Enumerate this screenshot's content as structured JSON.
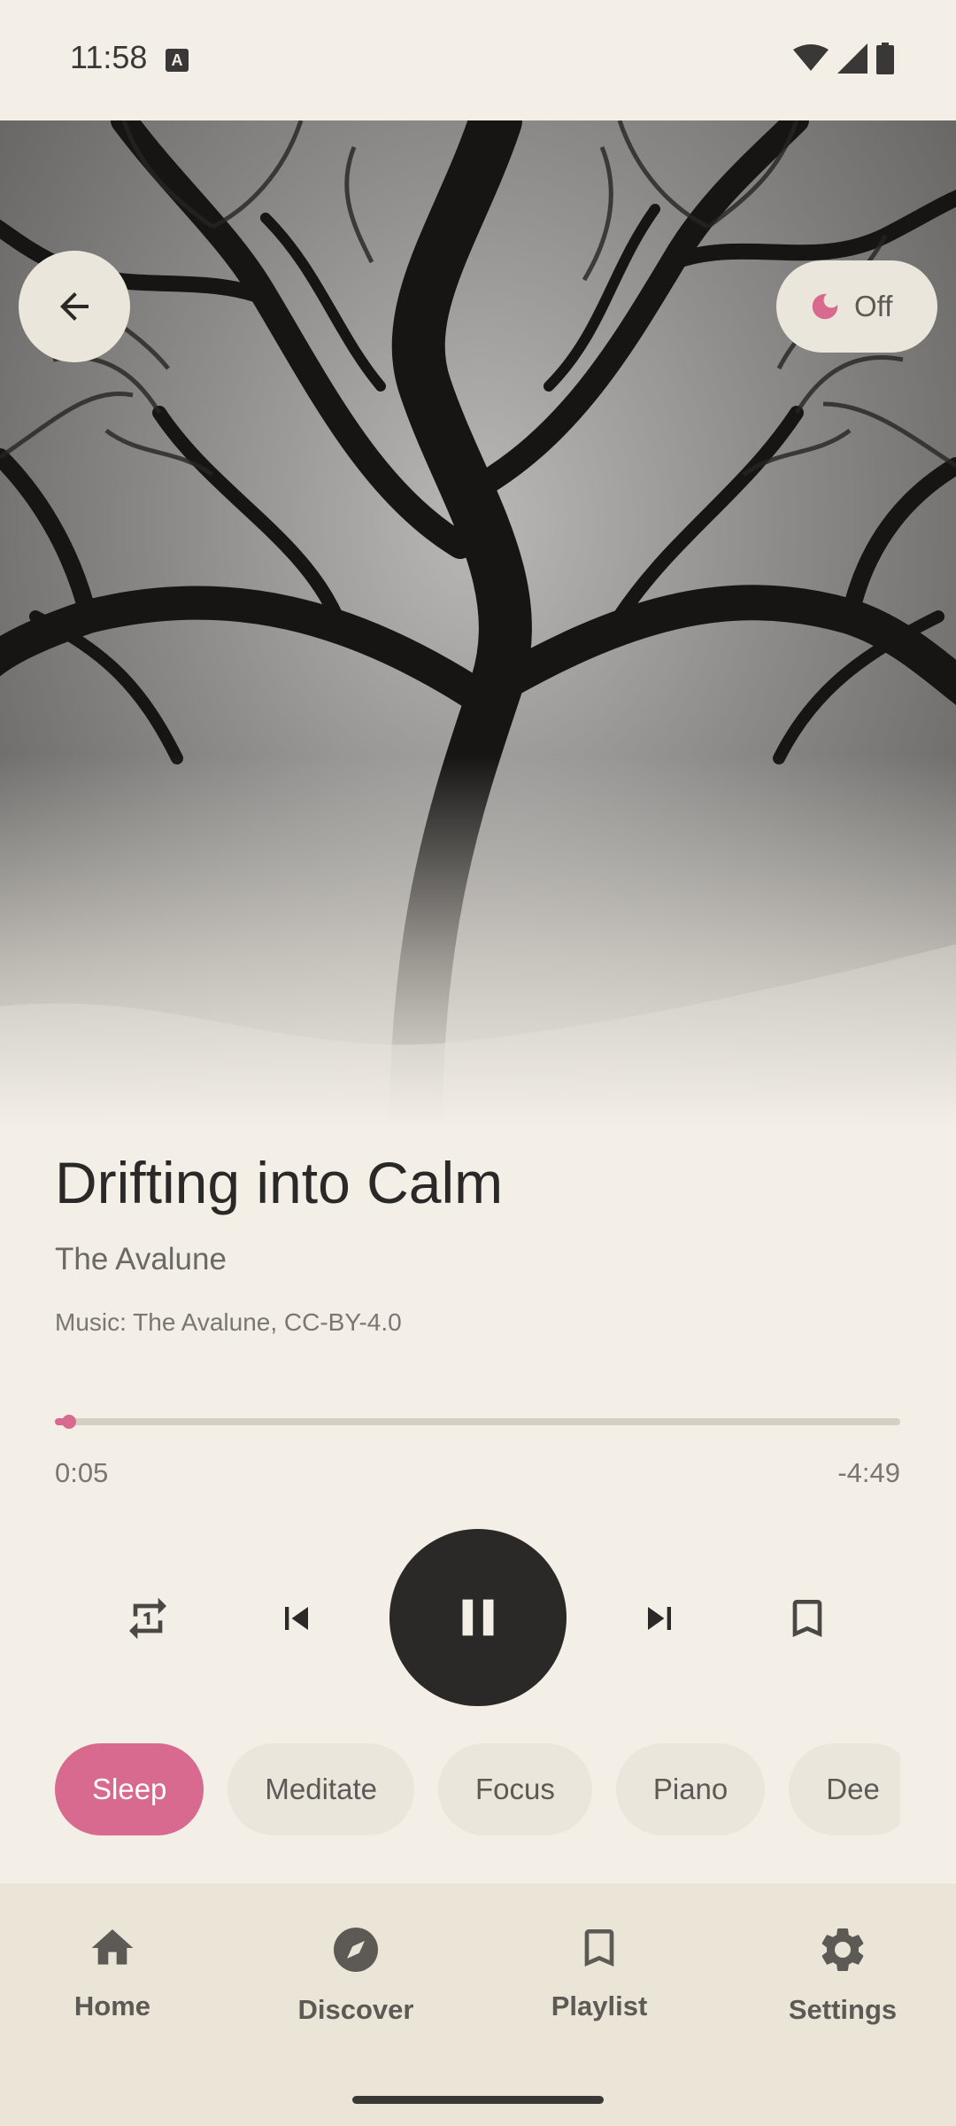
{
  "status_bar": {
    "time": "11:58",
    "notification_icon": "A"
  },
  "hero": {
    "image": "tree-silhouette-icon"
  },
  "back_button": {
    "icon": "arrow-back-icon"
  },
  "sleep_timer": {
    "icon": "moon-icon",
    "label": "Off"
  },
  "track": {
    "title": "Drifting into Calm",
    "artist": "The Avalune",
    "credit": "Music: The Avalune, CC-BY-4.0"
  },
  "progress": {
    "elapsed": "0:05",
    "remaining": "-4:49",
    "fraction": 0.017
  },
  "controls": {
    "repeat_icon": "repeat-one-icon",
    "prev_icon": "skip-previous-icon",
    "play_pause_icon": "pause-icon",
    "next_icon": "skip-next-icon",
    "bookmark_icon": "bookmark-icon"
  },
  "categories": [
    {
      "label": "Sleep",
      "active": true
    },
    {
      "label": "Meditate",
      "active": false
    },
    {
      "label": "Focus",
      "active": false
    },
    {
      "label": "Piano",
      "active": false
    },
    {
      "label": "Dee",
      "active": false
    }
  ],
  "nav": {
    "home": "Home",
    "discover": "Discover",
    "playlist": "Playlist",
    "settings": "Settings"
  },
  "colors": {
    "accent": "#d96a8f",
    "background": "#f3efe6",
    "dark": "#2b2928"
  }
}
